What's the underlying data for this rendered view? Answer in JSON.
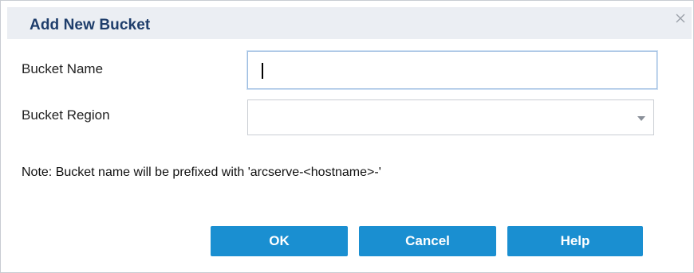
{
  "dialog": {
    "title": "Add New Bucket",
    "close_icon": "close-icon"
  },
  "form": {
    "bucket_name_label": "Bucket Name",
    "bucket_name_value": "",
    "bucket_region_label": "Bucket Region",
    "bucket_region_value": "",
    "dropdown_icon": "chevron-down-icon"
  },
  "note": "Note: Bucket name will be prefixed with 'arcserve-<hostname>-'",
  "buttons": {
    "ok": "OK",
    "cancel": "Cancel",
    "help": "Help"
  },
  "colors": {
    "title": "#1e3d6b",
    "titlebar_bg": "#ebeef3",
    "button_bg": "#1a8fd1",
    "button_text": "#ffffff",
    "input_focus_border": "#9bbbe0"
  }
}
